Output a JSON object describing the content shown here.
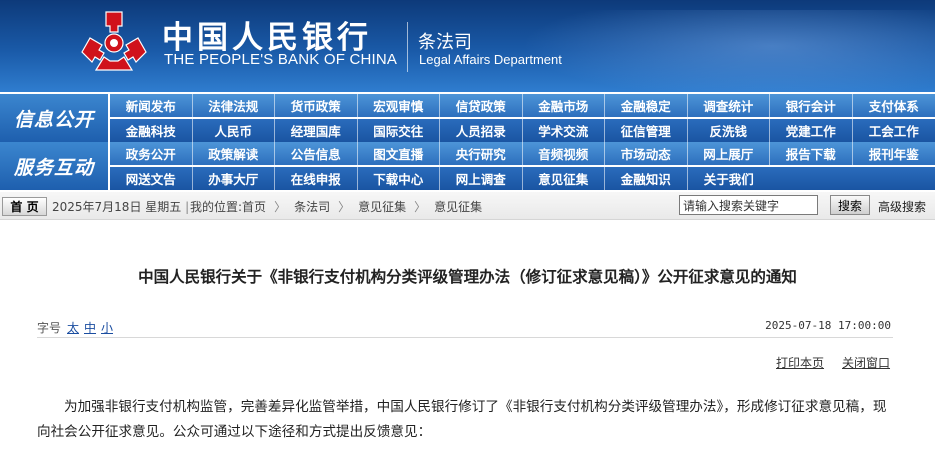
{
  "header": {
    "bank_name_cn": "中国人民银行",
    "bank_name_en": "THE PEOPLE'S BANK OF CHINA",
    "department_cn": "条法司",
    "department_en": "Legal Affairs Department"
  },
  "nav": {
    "info_title": "信息公开",
    "service_title": "服务互动",
    "info_row1": [
      "新闻发布",
      "法律法规",
      "货币政策",
      "宏观审慎",
      "信贷政策",
      "金融市场",
      "金融稳定",
      "调查统计",
      "银行会计",
      "支付体系"
    ],
    "info_row2": [
      "金融科技",
      "人民币",
      "经理国库",
      "国际交往",
      "人员招录",
      "学术交流",
      "征信管理",
      "反洗钱",
      "党建工作",
      "工会工作"
    ],
    "service_row1": [
      "政务公开",
      "政策解读",
      "公告信息",
      "图文直播",
      "央行研究",
      "音频视频",
      "市场动态",
      "网上展厅",
      "报告下载",
      "报刊年鉴"
    ],
    "service_row2": [
      "网送文告",
      "办事大厅",
      "在线申报",
      "下载中心",
      "网上调查",
      "意见征集",
      "金融知识",
      "关于我们"
    ]
  },
  "breadcrumb": {
    "home_label": "首  页",
    "date": "2025年7月18日  星期五",
    "location_prefix": "我的位置:",
    "items": [
      "首页",
      "条法司",
      "意见征集",
      "意见征集"
    ],
    "search_placeholder": "请输入搜索关键字",
    "search_button": "搜索",
    "advanced_search": "高级搜索"
  },
  "article": {
    "title": "中国人民银行关于《非银行支付机构分类评级管理办法（修订征求意见稿）》公开征求意见的通知",
    "font_size_label": "字号",
    "font_size_options": [
      "太",
      "中",
      "小"
    ],
    "publish_time": "2025-07-18 17:00:00",
    "print_label": "打印本页",
    "close_label": "关闭窗口",
    "body_paragraph": "为加强非银行支付机构监管，完善差异化监管举措，中国人民银行修订了《非银行支付机构分类评级管理办法》，形成修订征求意见稿，现向社会公开征求意见。公众可通过以下途径和方式提出反馈意见："
  },
  "colors": {
    "header_dark": "#0d3a7a",
    "nav_blue": "#1d5fae",
    "emblem_red": "#d0121b",
    "link_blue": "#1a4da0"
  }
}
